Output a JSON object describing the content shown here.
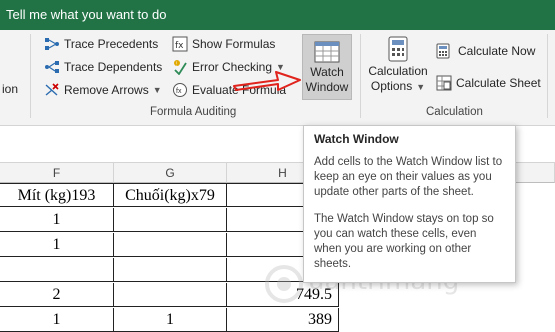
{
  "tellbar": {
    "text": "Tell me what you want to do"
  },
  "ribbon": {
    "left_stub_label": "ion",
    "formula_auditing": {
      "trace_precedents": "Trace Precedents",
      "trace_dependents": "Trace Dependents",
      "remove_arrows": "Remove Arrows",
      "show_formulas": "Show Formulas",
      "error_checking": "Error Checking",
      "evaluate_formula": "Evaluate Formula",
      "watch_window_line1": "Watch",
      "watch_window_line2": "Window",
      "group_label": "Formula Auditing"
    },
    "calculation": {
      "options_line1": "Calculation",
      "options_line2": "Options",
      "calculate_now": "Calculate Now",
      "calculate_sheet": "Calculate Sheet",
      "group_label": "Calculation"
    }
  },
  "sheet": {
    "col_f": "F",
    "col_g": "G",
    "col_h": "H",
    "header_f": "Mít (kg)193",
    "header_g": "Chuối(kg)x79",
    "rows": [
      {
        "f": "1",
        "g": "",
        "h": ""
      },
      {
        "f": "1",
        "g": "",
        "h": ""
      },
      {
        "f": "",
        "g": "",
        "h": ""
      },
      {
        "f": "2",
        "g": "",
        "h": "749.5"
      },
      {
        "f": "1",
        "g": "1",
        "h": "389"
      }
    ]
  },
  "tooltip": {
    "title": "Watch Window",
    "para1": "Add cells to the Watch Window list to keep an eye on their values as you update other parts of the sheet.",
    "para2": "The Watch Window stays on top so you can watch these cells, even when you are working on other sheets."
  },
  "watermark": {
    "text": "uantrimang"
  },
  "colors": {
    "accent": "#217346",
    "arrow": "#e0231c"
  }
}
